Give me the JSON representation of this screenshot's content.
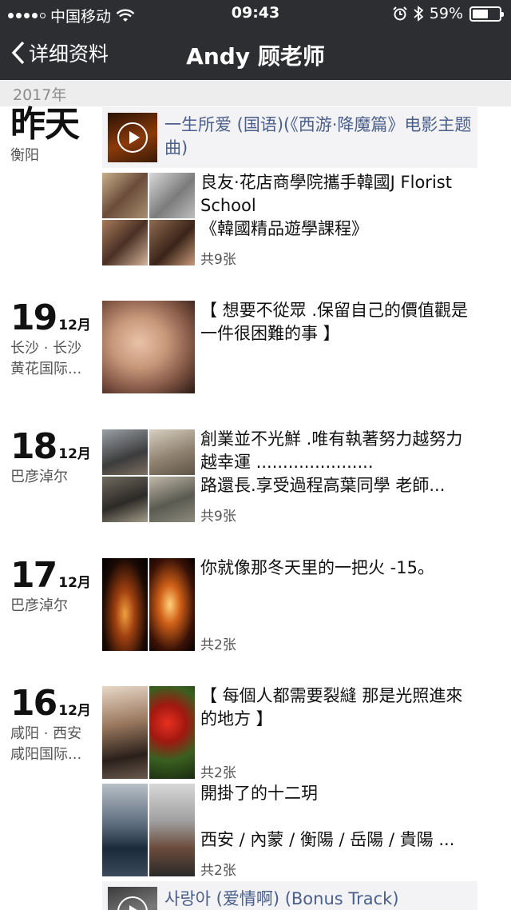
{
  "status_bar": {
    "carrier": "中国移动",
    "time": "09:43",
    "battery": "59%",
    "battery_level": 0.59
  },
  "nav": {
    "back_label": "详细资料",
    "title": "Andy 顾老师"
  },
  "year_label": "2017年",
  "days": [
    {
      "date_text": "昨天",
      "location": "衡阳",
      "music": {
        "title": "一生所爱 (国语)(《西游·降魔篇》电影主题曲)"
      },
      "post": {
        "text": "良友·花店商學院攜手韓國J Florist School\n《韓國精品遊學課程》",
        "count": "共9张"
      }
    },
    {
      "day": "19",
      "month": "12月",
      "location_line1": "长沙 · 长沙",
      "location_line2": "黄花国际...",
      "post": {
        "text": "【 想要不從眾 .保留自己的價值觀是一件很困難的事 】"
      }
    },
    {
      "day": "18",
      "month": "12月",
      "location": "巴彦淖尔",
      "post": {
        "text": "創業並不光鮮 .唯有執著努力越努力越幸運 ......................\n路還長.享受過程高葉同學 老師...",
        "count": "共9张"
      }
    },
    {
      "day": "17",
      "month": "12月",
      "location": "巴彦淖尔",
      "post": {
        "text": "你就像那冬天里的一把火  -15。",
        "count": "共2张"
      }
    },
    {
      "day": "16",
      "month": "12月",
      "location_line1": "咸阳 · 西安",
      "location_line2": "咸阳国际...",
      "post": {
        "text": "【 每個人都需要裂縫 那是光照進來的地方 】",
        "count": "共2张"
      },
      "post2": {
        "text": "開掛了的十二玥\n\n西安 / 內蒙 / 衡陽 / 岳陽 / 貴陽 ...",
        "count": "共2张"
      },
      "music": {
        "title": "사랑아 (爱情啊) (Bonus Track)"
      }
    }
  ]
}
